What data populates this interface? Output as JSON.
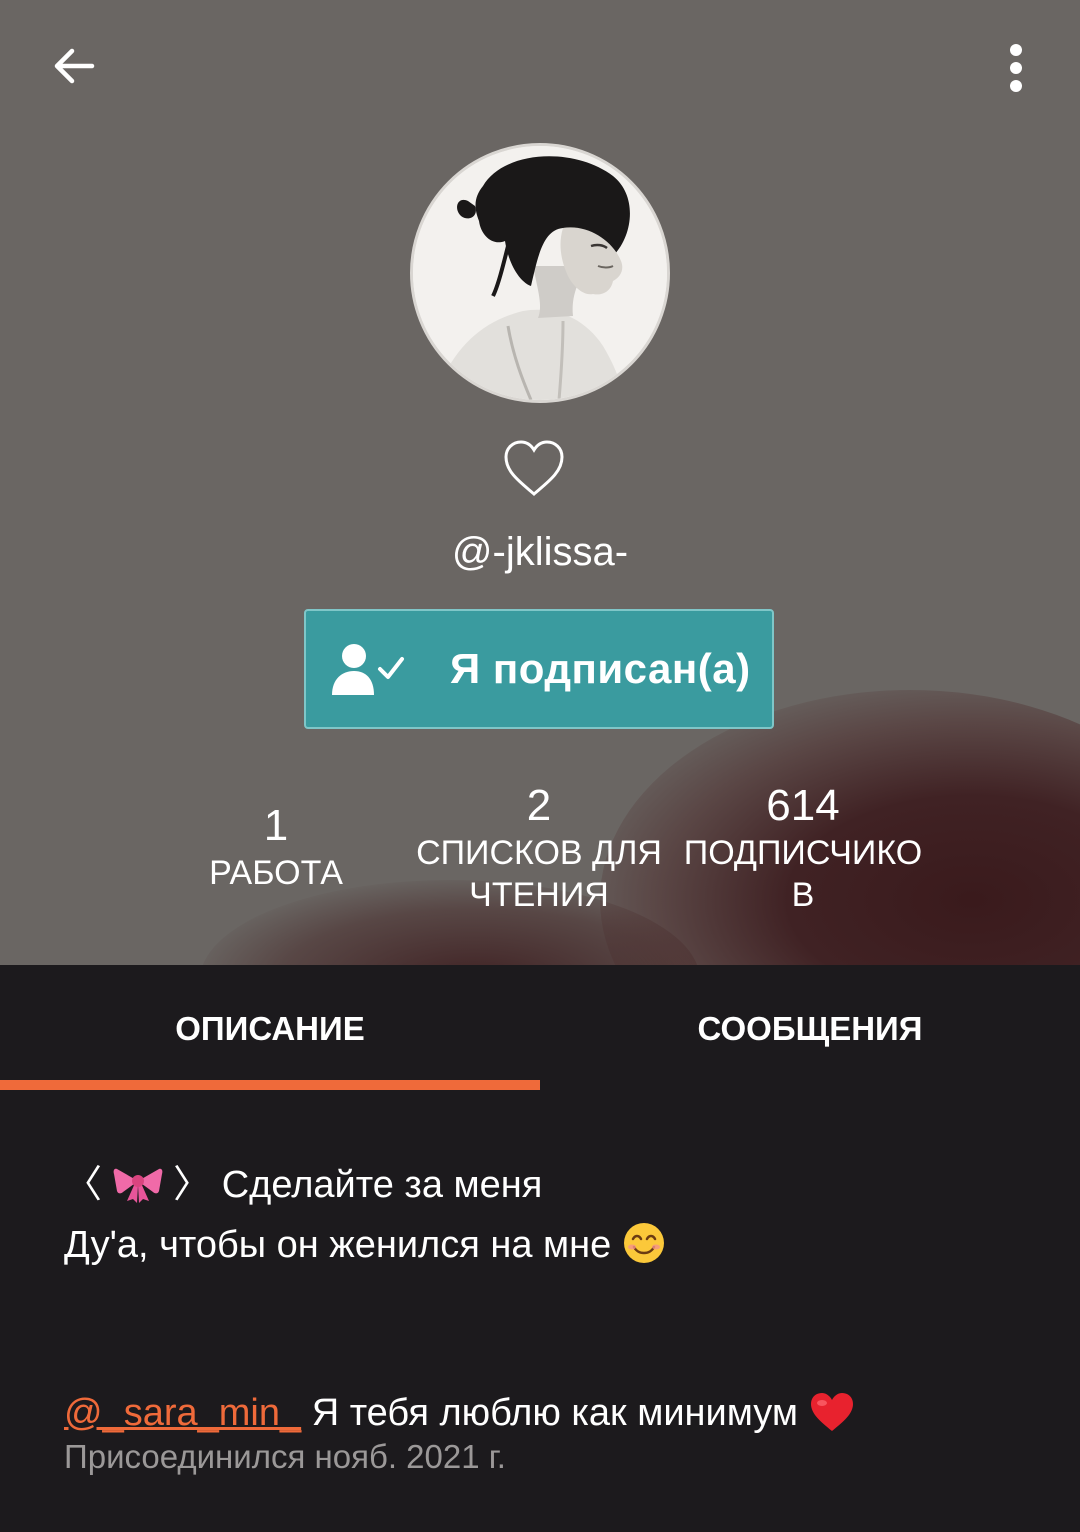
{
  "header": {
    "username": "@-jklissa-",
    "follow_label": "Я подписан(а)"
  },
  "stats": [
    {
      "value": "1",
      "label": "РАБОТА"
    },
    {
      "value": "2",
      "label_line1": "СПИСКОВ ДЛЯ",
      "label_line2": "ЧТЕНИЯ"
    },
    {
      "value": "614",
      "label_line1": "ПОДПИСЧИКО",
      "label_line2": "В"
    }
  ],
  "tabs": {
    "description": "ОПИСАНИЕ",
    "messages": "СООБЩЕНИЯ",
    "active": "description"
  },
  "description": {
    "bracket_open": "〈",
    "bracket_close": "〉",
    "line1_text": "Сделайте за меня",
    "line2_text": "Ду'а, чтобы он женился на мне",
    "mention": "@_sara_min_",
    "line3_text": "Я тебя люблю как минимум",
    "joined": "Присоединился нояб. 2021 г."
  },
  "colors": {
    "header_bg": "#6a6663",
    "follow_button": "#3a9b9f",
    "accent": "#ef6a3a",
    "page_bg": "#1c1a1d"
  },
  "icons": [
    "back-arrow-icon",
    "more-vertical-icon",
    "heart-outline-icon",
    "user-check-icon",
    "bow-emoji-icon",
    "smile-emoji-icon",
    "red-heart-emoji-icon"
  ]
}
